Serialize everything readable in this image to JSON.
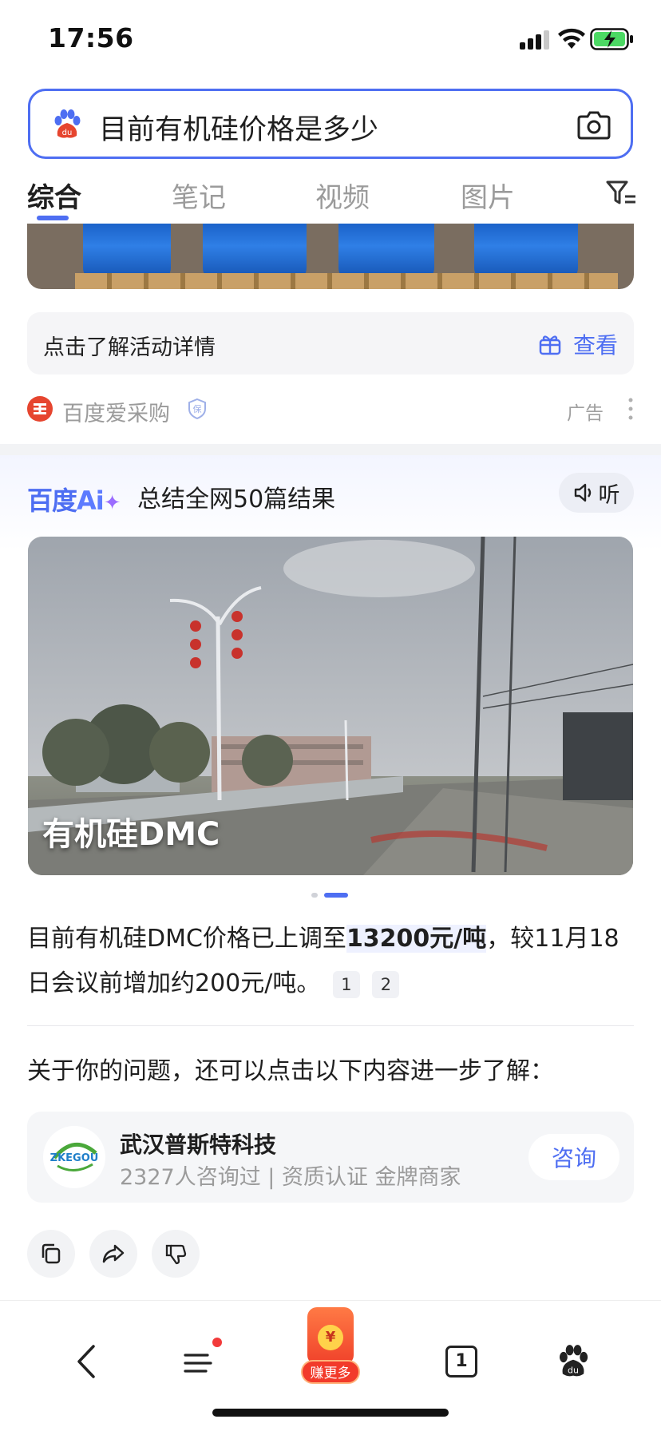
{
  "status_bar": {
    "time": "17:56"
  },
  "search": {
    "query": "目前有机硅价格是多少"
  },
  "tabs": [
    {
      "label": "综合",
      "active": true
    },
    {
      "label": "笔记",
      "active": false
    },
    {
      "label": "视频",
      "active": false
    },
    {
      "label": "图片",
      "active": false
    }
  ],
  "ad": {
    "activity_text": "点击了解活动详情",
    "view_label": "查看",
    "source_name": "百度爱采购",
    "badge": "保",
    "ad_label": "广告"
  },
  "ai": {
    "logo_text": "百度",
    "logo_ai": "Ai",
    "summary": "总结全网50篇结果",
    "listen_label": "听",
    "photo_caption": "有机硅DMC",
    "answer_prefix": "目前有机硅DMC价格已上调至",
    "answer_highlight": "13200元/吨",
    "answer_suffix": "，较11月18日会议前增加约200元/吨。",
    "citations": [
      "1",
      "2"
    ],
    "further_text": "关于你的问题，还可以点击以下内容进一步了解："
  },
  "merchant": {
    "logo_text": "ZKEGOU",
    "name": "武汉普斯特科技",
    "meta": "2327人咨询过 | 资质认证 金牌商家",
    "consult_label": "咨询"
  },
  "bottom_nav": {
    "earn_label": "赚更多",
    "earn_coin": "¥",
    "tab_count": "1"
  },
  "colors": {
    "accent": "#4e6ef2",
    "ad_red": "#e6452f"
  }
}
